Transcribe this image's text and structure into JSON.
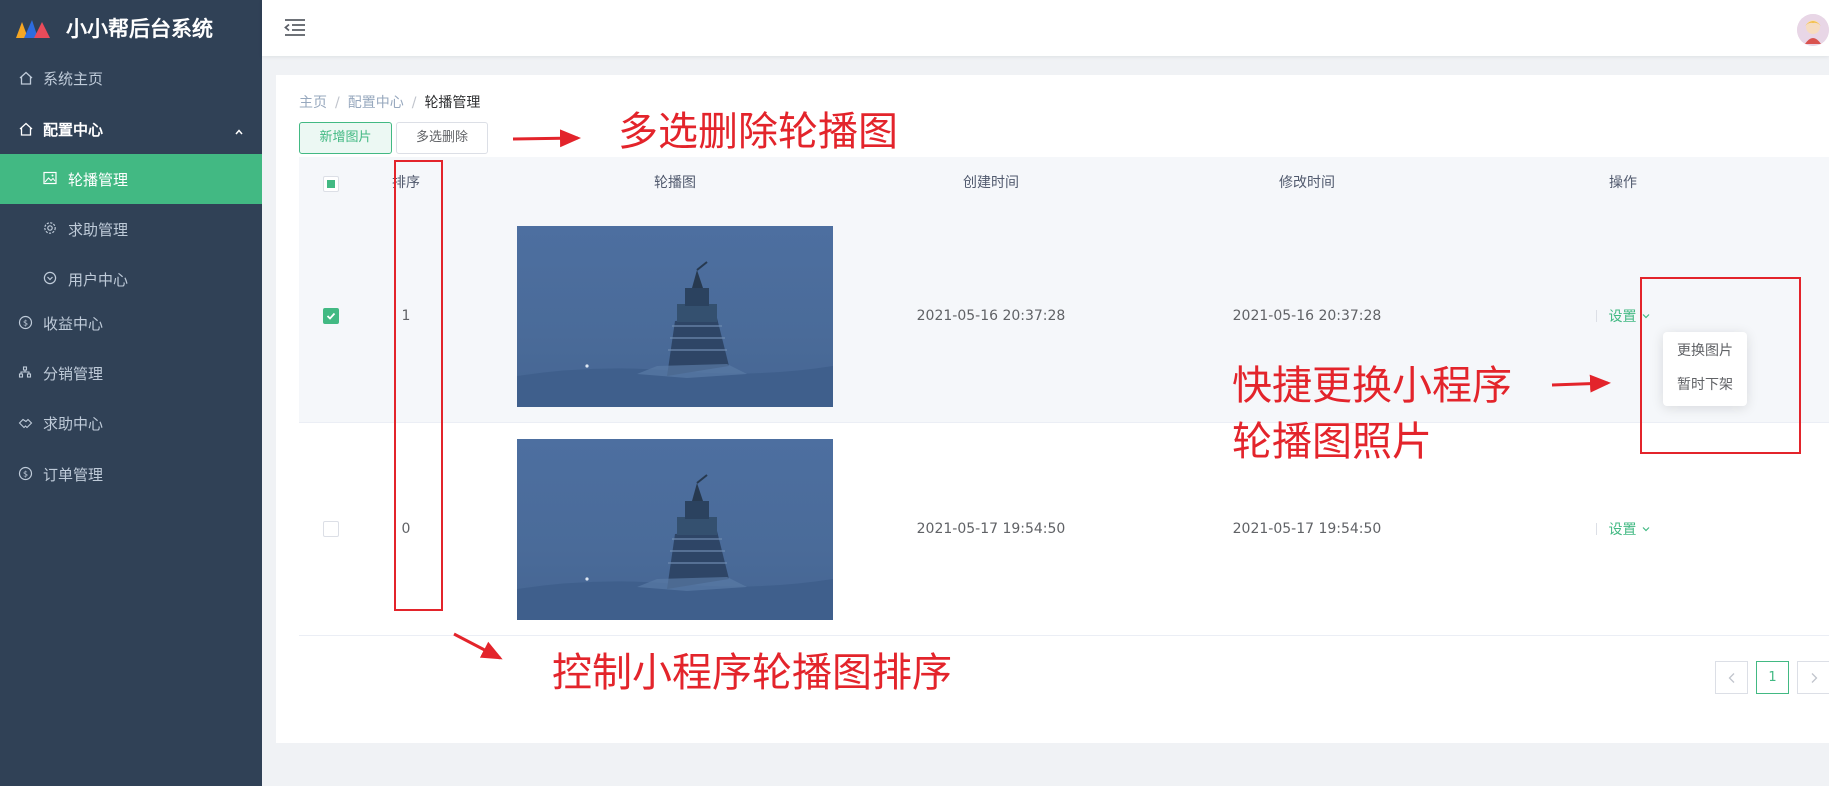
{
  "app": {
    "title": "小小帮后台系统"
  },
  "sidebar": {
    "items": [
      {
        "label": "系统主页",
        "icon": "home-icon"
      },
      {
        "label": "配置中心",
        "icon": "home-icon",
        "expanded": true
      },
      {
        "label": "轮播管理",
        "icon": "picture-icon",
        "active": true
      },
      {
        "label": "求助管理",
        "icon": "gear-icon"
      },
      {
        "label": "用户中心",
        "icon": "circle-check-icon"
      },
      {
        "label": "收益中心",
        "icon": "coin-icon"
      },
      {
        "label": "分销管理",
        "icon": "org-chart-icon"
      },
      {
        "label": "求助中心",
        "icon": "handshake-icon"
      },
      {
        "label": "订单管理",
        "icon": "coin-icon"
      }
    ]
  },
  "breadcrumb": {
    "items": [
      "主页",
      "配置中心",
      "轮播管理"
    ]
  },
  "toolbar": {
    "add_label": "新增图片",
    "batch_delete_label": "多选删除"
  },
  "table": {
    "headers": {
      "sort": "排序",
      "image": "轮播图",
      "created": "创建时间",
      "modified": "修改时间",
      "actions": "操作"
    },
    "rows": [
      {
        "checked": true,
        "sort": "1",
        "created": "2021-05-16 20:37:28",
        "modified": "2021-05-16 20:37:28",
        "action": "设置"
      },
      {
        "checked": false,
        "sort": "0",
        "created": "2021-05-17 19:54:50",
        "modified": "2021-05-17 19:54:50",
        "action": "设置"
      }
    ]
  },
  "dropdown": {
    "items": [
      "更换图片",
      "暂时下架"
    ]
  },
  "pagination": {
    "current": "1"
  },
  "annotations": {
    "batch_delete": "多选删除轮播图",
    "replace_line1": "快捷更换小程序",
    "replace_line2": "轮播图照片",
    "sort": "控制小程序轮播图排序"
  },
  "colors": {
    "sidebar_bg": "#304156",
    "accent": "#42b983",
    "annotation_red": "#e3242b"
  }
}
